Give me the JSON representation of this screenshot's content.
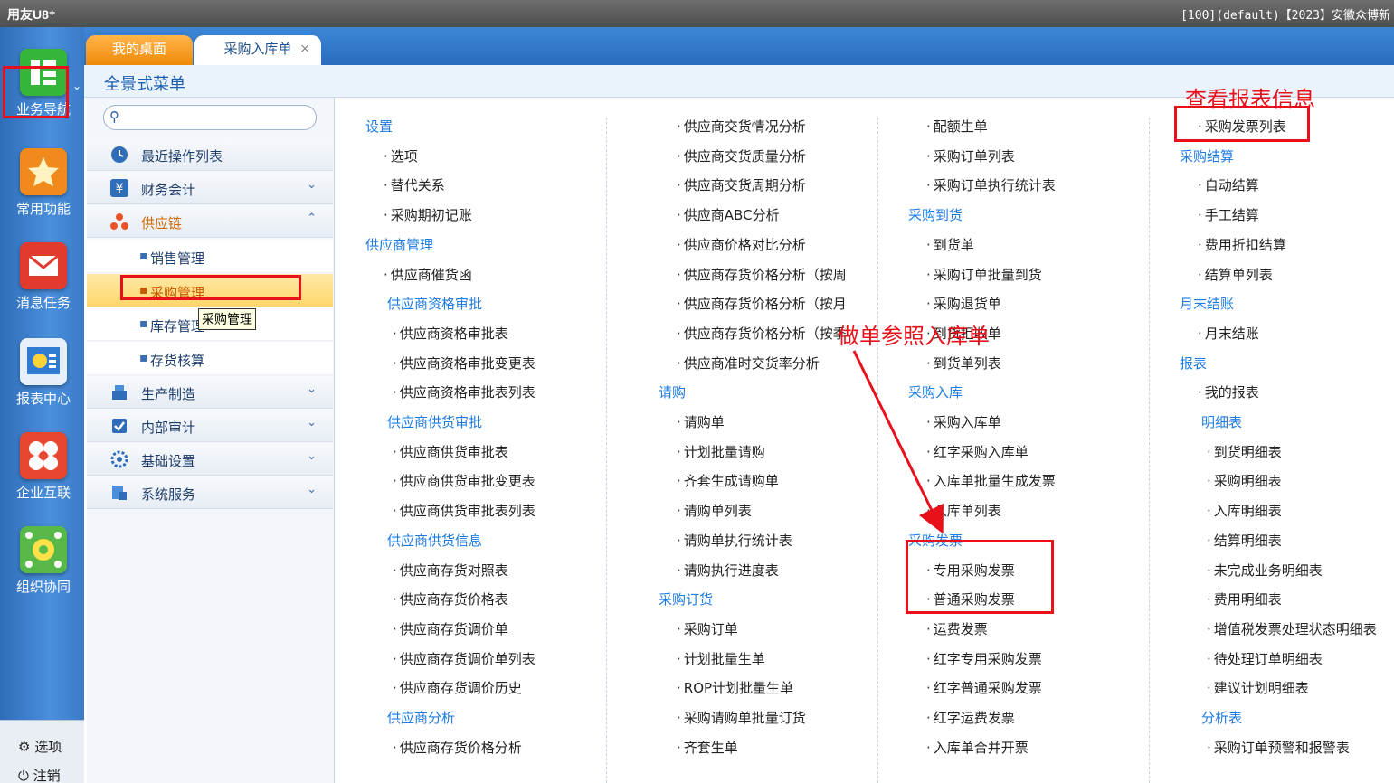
{
  "titlebar": {
    "logo": "用友U8⁺",
    "info": "[100](default)【2023】安徽众博新"
  },
  "rail": {
    "items": [
      {
        "label": "业务导航",
        "icon": "business-nav-icon",
        "color": "#35b53a"
      },
      {
        "label": "常用功能",
        "icon": "star-icon",
        "color": "#f08a1c"
      },
      {
        "label": "消息任务",
        "icon": "envelope-icon",
        "color": "#e33a2e"
      },
      {
        "label": "报表中心",
        "icon": "report-icon",
        "color": "#2f7bd4"
      },
      {
        "label": "企业互联",
        "icon": "butterfly-icon",
        "color": "#e8452e"
      },
      {
        "label": "组织协同",
        "icon": "gear-network-icon",
        "color": "#58b848"
      }
    ],
    "options_label": "选项",
    "logout_label": "注销"
  },
  "tabs": {
    "home": "我的桌面",
    "receipt": "采购入库单",
    "close": "×"
  },
  "menu_title": "全景式菜单",
  "search": {
    "placeholder": ""
  },
  "tree": {
    "categories": [
      {
        "label": "最近操作列表",
        "icon": "clock-icon"
      },
      {
        "label": "财务会计",
        "icon": "yen-icon"
      },
      {
        "label": "供应链",
        "icon": "supply-chain-icon"
      },
      {
        "label": "生产制造",
        "icon": "factory-icon"
      },
      {
        "label": "内部审计",
        "icon": "audit-icon"
      },
      {
        "label": "基础设置",
        "icon": "settings-icon"
      },
      {
        "label": "系统服务",
        "icon": "system-icon"
      }
    ],
    "supply_subitems": [
      "销售管理",
      "采购管理",
      "库存管理",
      "存货核算"
    ],
    "tooltip": "采购管理"
  },
  "menu": {
    "col1": [
      {
        "t": "h",
        "text": "设置"
      },
      {
        "t": "i",
        "text": "选项"
      },
      {
        "t": "i",
        "text": "替代关系"
      },
      {
        "t": "i",
        "text": "采购期初记账"
      },
      {
        "t": "h",
        "text": "供应商管理"
      },
      {
        "t": "i",
        "text": "供应商催货函"
      },
      {
        "t": "h2",
        "text": "供应商资格审批"
      },
      {
        "t": "i2",
        "text": "供应商资格审批表"
      },
      {
        "t": "i2",
        "text": "供应商资格审批变更表"
      },
      {
        "t": "i2",
        "text": "供应商资格审批表列表"
      },
      {
        "t": "h2",
        "text": "供应商供货审批"
      },
      {
        "t": "i2",
        "text": "供应商供货审批表"
      },
      {
        "t": "i2",
        "text": "供应商供货审批变更表"
      },
      {
        "t": "i2",
        "text": "供应商供货审批表列表"
      },
      {
        "t": "h2",
        "text": "供应商供货信息"
      },
      {
        "t": "i2",
        "text": "供应商存货对照表"
      },
      {
        "t": "i2",
        "text": "供应商存货价格表"
      },
      {
        "t": "i2",
        "text": "供应商存货调价单"
      },
      {
        "t": "i2",
        "text": "供应商存货调价单列表"
      },
      {
        "t": "i2",
        "text": "供应商存货调价历史"
      },
      {
        "t": "h2",
        "text": "供应商分析"
      },
      {
        "t": "i2",
        "text": "供应商存货价格分析"
      }
    ],
    "col2": [
      {
        "t": "i",
        "text": "供应商交货情况分析"
      },
      {
        "t": "i",
        "text": "供应商交货质量分析"
      },
      {
        "t": "i",
        "text": "供应商交货周期分析"
      },
      {
        "t": "i",
        "text": "供应商ABC分析"
      },
      {
        "t": "i",
        "text": "供应商价格对比分析"
      },
      {
        "t": "i",
        "text": "供应商存货价格分析（按周"
      },
      {
        "t": "i",
        "text": "供应商存货价格分析（按月"
      },
      {
        "t": "i",
        "text": "供应商存货价格分析（按季"
      },
      {
        "t": "i",
        "text": "供应商准时交货率分析"
      },
      {
        "t": "h",
        "text": "请购"
      },
      {
        "t": "i",
        "text": "请购单"
      },
      {
        "t": "i",
        "text": "计划批量请购"
      },
      {
        "t": "i",
        "text": "齐套生成请购单"
      },
      {
        "t": "i",
        "text": "请购单列表"
      },
      {
        "t": "i",
        "text": "请购单执行统计表"
      },
      {
        "t": "i",
        "text": "请购执行进度表"
      },
      {
        "t": "h",
        "text": "采购订货"
      },
      {
        "t": "i",
        "text": "采购订单"
      },
      {
        "t": "i",
        "text": "计划批量生单"
      },
      {
        "t": "i",
        "text": "ROP计划批量生单"
      },
      {
        "t": "i",
        "text": "采购请购单批量订货"
      },
      {
        "t": "i",
        "text": "齐套生单"
      }
    ],
    "col3": [
      {
        "t": "i",
        "text": "配额生单"
      },
      {
        "t": "i",
        "text": "采购订单列表"
      },
      {
        "t": "i",
        "text": "采购订单执行统计表"
      },
      {
        "t": "h",
        "text": "采购到货"
      },
      {
        "t": "i",
        "text": "到货单"
      },
      {
        "t": "i",
        "text": "采购订单批量到货"
      },
      {
        "t": "i",
        "text": "采购退货单"
      },
      {
        "t": "i",
        "text": "到货拒收单"
      },
      {
        "t": "i",
        "text": "到货单列表"
      },
      {
        "t": "h",
        "text": "采购入库"
      },
      {
        "t": "i",
        "text": "采购入库单"
      },
      {
        "t": "i",
        "text": "红字采购入库单"
      },
      {
        "t": "i",
        "text": "入库单批量生成发票"
      },
      {
        "t": "i",
        "text": "入库单列表"
      },
      {
        "t": "h",
        "text": "采购发票"
      },
      {
        "t": "i",
        "text": "专用采购发票"
      },
      {
        "t": "i",
        "text": "普通采购发票"
      },
      {
        "t": "i",
        "text": "运费发票"
      },
      {
        "t": "i",
        "text": "红字专用采购发票"
      },
      {
        "t": "i",
        "text": "红字普通采购发票"
      },
      {
        "t": "i",
        "text": "红字运费发票"
      },
      {
        "t": "i",
        "text": "入库单合并开票"
      }
    ],
    "col4": [
      {
        "t": "i",
        "text": "采购发票列表"
      },
      {
        "t": "h",
        "text": "采购结算"
      },
      {
        "t": "i",
        "text": "自动结算"
      },
      {
        "t": "i",
        "text": "手工结算"
      },
      {
        "t": "i",
        "text": "费用折扣结算"
      },
      {
        "t": "i",
        "text": "结算单列表"
      },
      {
        "t": "h",
        "text": "月末结账"
      },
      {
        "t": "i",
        "text": "月末结账"
      },
      {
        "t": "h",
        "text": "报表"
      },
      {
        "t": "i",
        "text": "我的报表"
      },
      {
        "t": "h2",
        "text": "明细表"
      },
      {
        "t": "i2",
        "text": "到货明细表"
      },
      {
        "t": "i2",
        "text": "采购明细表"
      },
      {
        "t": "i2",
        "text": "入库明细表"
      },
      {
        "t": "i2",
        "text": "结算明细表"
      },
      {
        "t": "i2",
        "text": "未完成业务明细表"
      },
      {
        "t": "i2",
        "text": "费用明细表"
      },
      {
        "t": "i2",
        "text": "增值税发票处理状态明细表"
      },
      {
        "t": "i2",
        "text": "待处理订单明细表"
      },
      {
        "t": "i2",
        "text": "建议计划明细表"
      },
      {
        "t": "h2",
        "text": "分析表"
      },
      {
        "t": "i2",
        "text": "采购订单预警和报警表"
      }
    ]
  },
  "annotations": {
    "report_info": "查看报表信息",
    "make_receipt": "做单参照入库单"
  },
  "colors": {
    "accent_blue": "#1d7be0",
    "annotation_red": "#e8101b",
    "rail_blue": "#3a7bc8"
  }
}
